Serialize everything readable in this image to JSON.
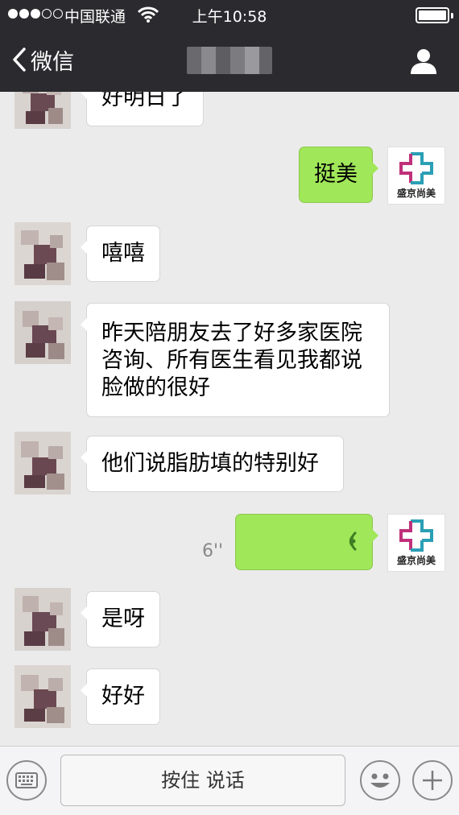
{
  "status_bar": {
    "carrier": "中国联通",
    "time": "上午10:58",
    "signal_bars_filled": 3,
    "signal_bars_total": 5
  },
  "nav": {
    "back_label": "微信",
    "title": "",
    "icons": {
      "back": "chevron-left-icon",
      "contact": "person-icon"
    }
  },
  "clinic_logo_text": "盛京尚美",
  "messages": [
    {
      "side": "left",
      "text": "好明日了"
    },
    {
      "side": "right",
      "text": "挺美"
    },
    {
      "side": "left",
      "text": "嘻嘻"
    },
    {
      "side": "left",
      "lines": [
        "昨天陪朋友去了好多家医院",
        "咨询、所有医生看见我都说",
        "脸做的很好"
      ]
    },
    {
      "side": "left",
      "text": "他们说脂肪填的特别好"
    },
    {
      "side": "right",
      "type": "voice",
      "duration": "6''"
    },
    {
      "side": "left",
      "text": "是呀"
    },
    {
      "side": "left",
      "text": "好好"
    }
  ],
  "input_bar": {
    "hold_to_talk_label": "按住 说话",
    "icons": {
      "keyboard": "keyboard-icon",
      "emoji": "emoji-icon",
      "add": "plus-icon"
    }
  },
  "colors": {
    "nav_background": "#2b2b2f",
    "chat_background": "#ebebeb",
    "sent_bubble": "#a0e759",
    "received_bubble": "#ffffff",
    "logo_teal": "#2a9fb5",
    "logo_magenta": "#c0307a"
  }
}
